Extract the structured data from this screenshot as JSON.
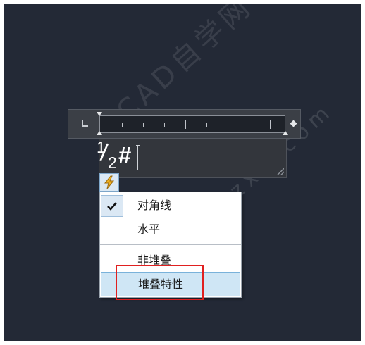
{
  "editor": {
    "numerator": "1",
    "slash": "/",
    "denominator": "2",
    "hash": "#"
  },
  "icons": {
    "autostack": "lightning-icon",
    "tab_stop": "left-tab-stop-icon",
    "check": "checkmark-icon"
  },
  "menu": {
    "items": [
      {
        "label": "对角线",
        "checked": true
      },
      {
        "label": "水平",
        "checked": false
      },
      {
        "label": "非堆叠",
        "checked": false
      },
      {
        "label": "堆叠特性",
        "checked": false,
        "highlighted": true
      }
    ]
  },
  "colors": {
    "background": "#232936",
    "menu_highlight": "#cfe6f5",
    "annotation_red": "#e02020",
    "autostack_icon": "#f0b020"
  },
  "watermark": {
    "line1": "CAD自学网",
    "line2": "www.cadzxw.com"
  }
}
